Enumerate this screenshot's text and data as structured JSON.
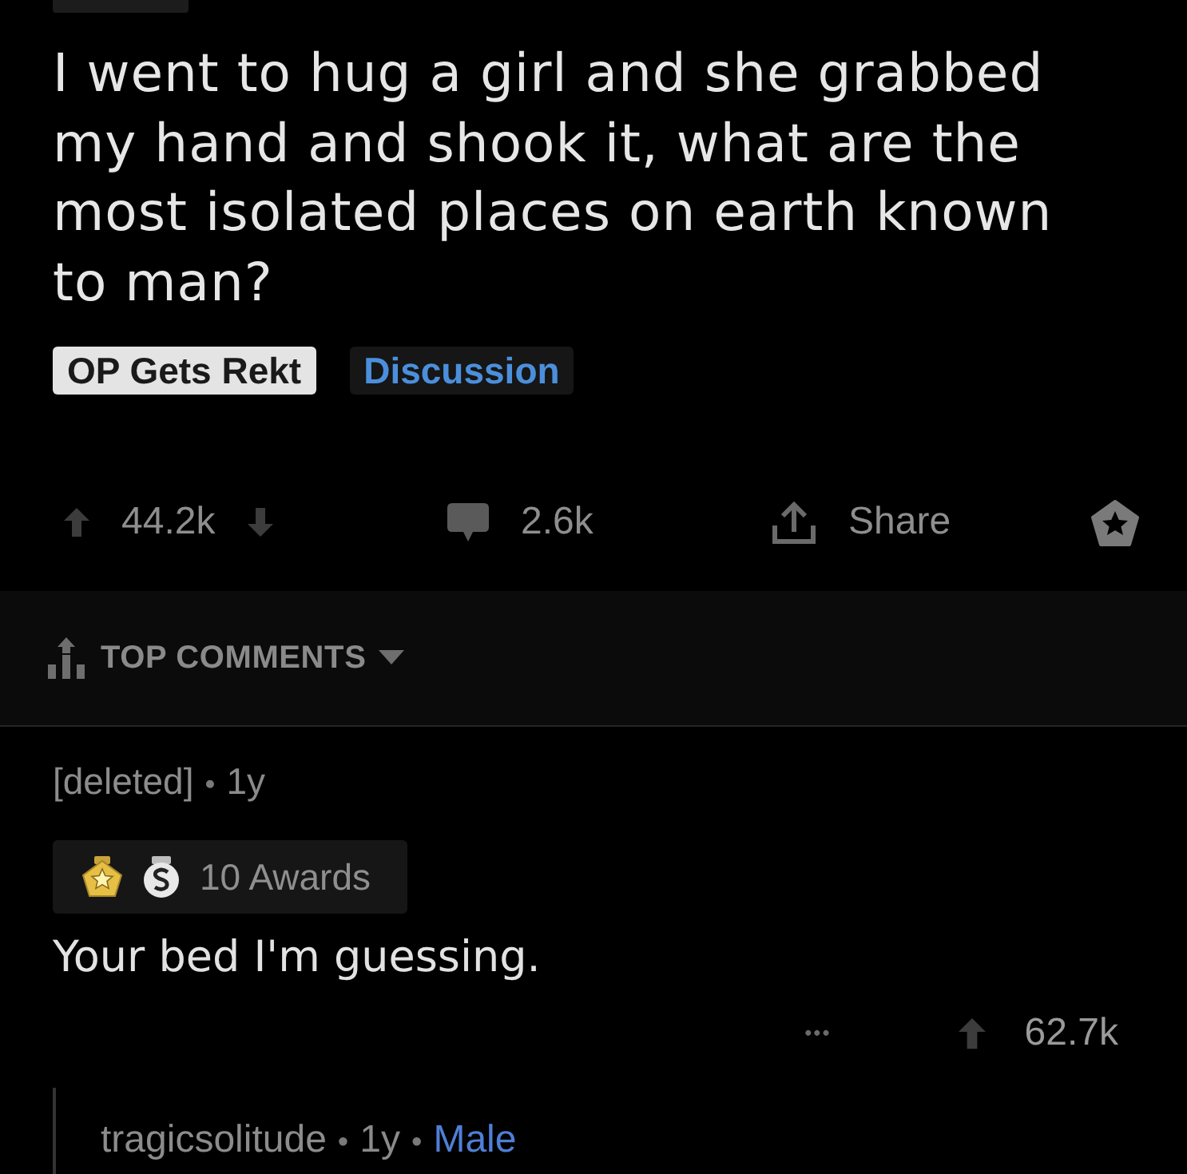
{
  "post": {
    "title": "I went to hug a girl and she grabbed my hand and shook it, what are the most isolated places on earth known to man?",
    "flairs": [
      {
        "text": "OP Gets Rekt",
        "kind": "light"
      },
      {
        "text": "Discussion",
        "kind": "dark"
      }
    ],
    "votes": "44.2k",
    "comments": "2.6k",
    "share": "Share"
  },
  "sort": {
    "label": "TOP COMMENTS"
  },
  "comments": [
    {
      "meta": [
        {
          "text": "[deleted]",
          "kind": "author"
        },
        {
          "text": "•",
          "kind": "dot"
        },
        {
          "text": "1y",
          "kind": "age"
        }
      ],
      "awards": "10 Awards",
      "body": "Your bed I'm guessing.",
      "more": "•••",
      "votes": "62.7k",
      "replies": [
        {
          "meta": [
            {
              "text": "tragicsolitude",
              "kind": "author"
            },
            {
              "text": "•",
              "kind": "dot"
            },
            {
              "text": "1y",
              "kind": "age"
            },
            {
              "text": "•",
              "kind": "dot"
            },
            {
              "text": "Male",
              "kind": "flair"
            }
          ]
        }
      ]
    }
  ]
}
